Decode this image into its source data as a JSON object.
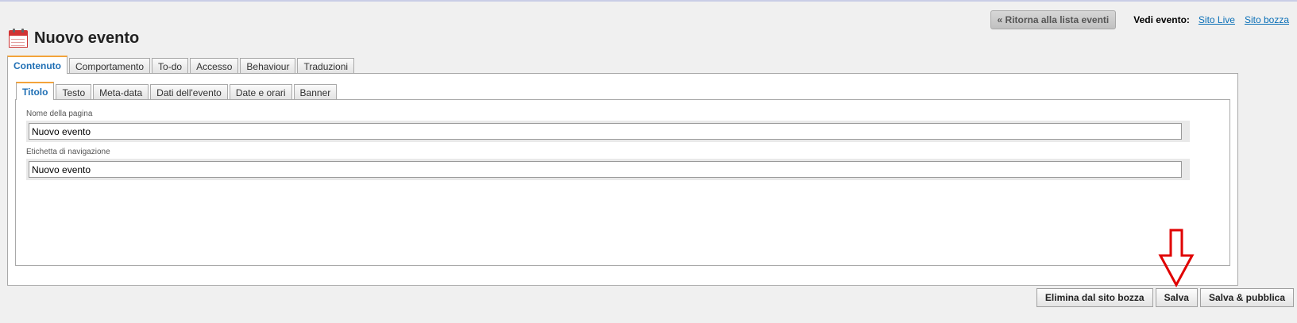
{
  "header": {
    "back_button": "« Ritorna alla lista eventi",
    "view_label": "Vedi evento:",
    "links": [
      "Sito Live",
      "Sito bozza"
    ]
  },
  "page": {
    "title": "Nuovo evento",
    "icon": "calendar-icon"
  },
  "outer_tabs": [
    "Contenuto",
    "Comportamento",
    "To-do",
    "Accesso",
    "Behaviour",
    "Traduzioni"
  ],
  "outer_active": "Contenuto",
  "inner_tabs": [
    "Titolo",
    "Testo",
    "Meta-data",
    "Dati dell'evento",
    "Date e orari",
    "Banner"
  ],
  "inner_active": "Titolo",
  "fields": {
    "page_name": {
      "label": "Nome della pagina",
      "value": "Nuovo evento"
    },
    "nav_label": {
      "label": "Etichetta di navigazione",
      "value": "Nuovo evento"
    }
  },
  "actions": {
    "delete": "Elimina dal sito bozza",
    "save": "Salva",
    "save_publish": "Salva & pubblica"
  },
  "colors": {
    "accent_link": "#0a6fb7",
    "active_tab_border": "#f3a33a",
    "annotation_arrow": "#e00000"
  }
}
